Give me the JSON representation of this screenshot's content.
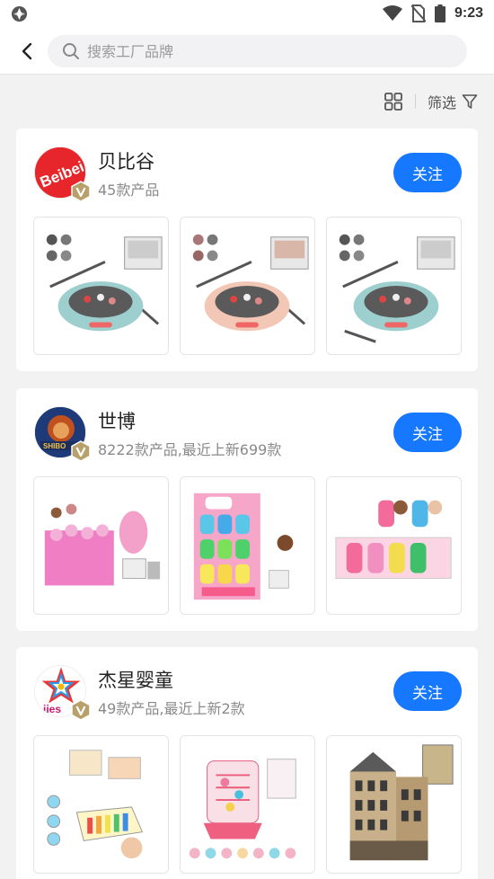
{
  "status_bar": {
    "time": "9:23"
  },
  "search": {
    "placeholder": "搜索工厂品牌"
  },
  "filter": {
    "label": "筛选"
  },
  "factories": [
    {
      "name": "贝比谷",
      "subtitle": "45款产品",
      "follow_label": "关注",
      "logo_text": "Beibei"
    },
    {
      "name": "世博",
      "subtitle": "8222款产品,最近上新699款",
      "follow_label": "关注",
      "logo_text": "SHIBO"
    },
    {
      "name": "杰星婴童",
      "subtitle": "49款产品,最近上新2款",
      "follow_label": "关注",
      "logo_text": "jies"
    }
  ],
  "colors": {
    "accent": "#1677ff",
    "background": "#f2f2f3",
    "badge_gold": "#b8a06a"
  }
}
